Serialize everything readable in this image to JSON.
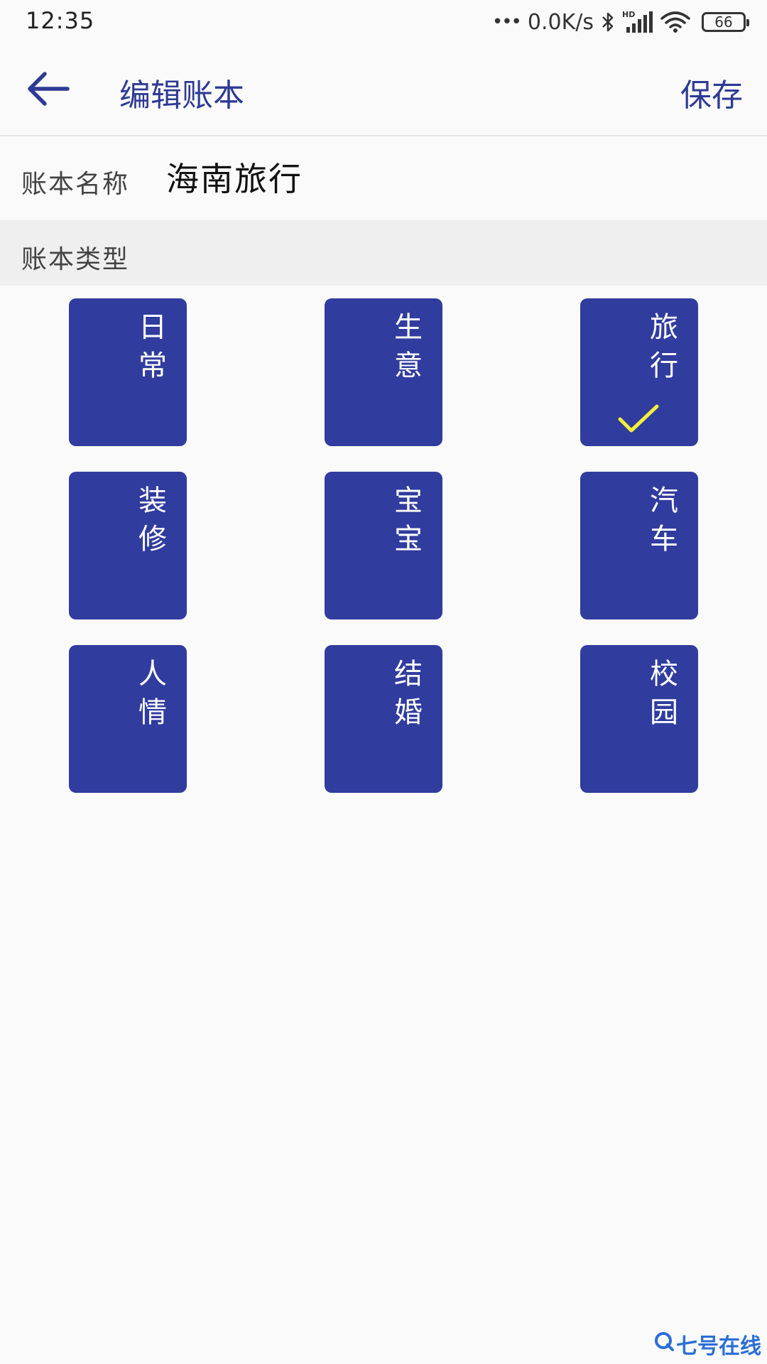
{
  "status_bar": {
    "time": "12:35",
    "dots": "•••",
    "network_speed": "0.0K/s",
    "hd_label": "HD",
    "battery": "66"
  },
  "app_bar": {
    "back_icon": "arrow-left-icon",
    "title": "编辑账本",
    "save_label": "保存"
  },
  "name_row": {
    "label": "账本名称",
    "value": "海南旅行"
  },
  "type_section": {
    "title": "账本类型",
    "selected": "旅行",
    "items": [
      {
        "label": "日常"
      },
      {
        "label": "生意"
      },
      {
        "label": "旅行"
      },
      {
        "label": "装修"
      },
      {
        "label": "宝宝"
      },
      {
        "label": "汽车"
      },
      {
        "label": "人情"
      },
      {
        "label": "结婚"
      },
      {
        "label": "校园"
      }
    ]
  },
  "colors": {
    "accent": "#2e3a94",
    "card": "#303c9e",
    "check": "#f4ef3c"
  },
  "watermark": {
    "text": "七号在线"
  }
}
